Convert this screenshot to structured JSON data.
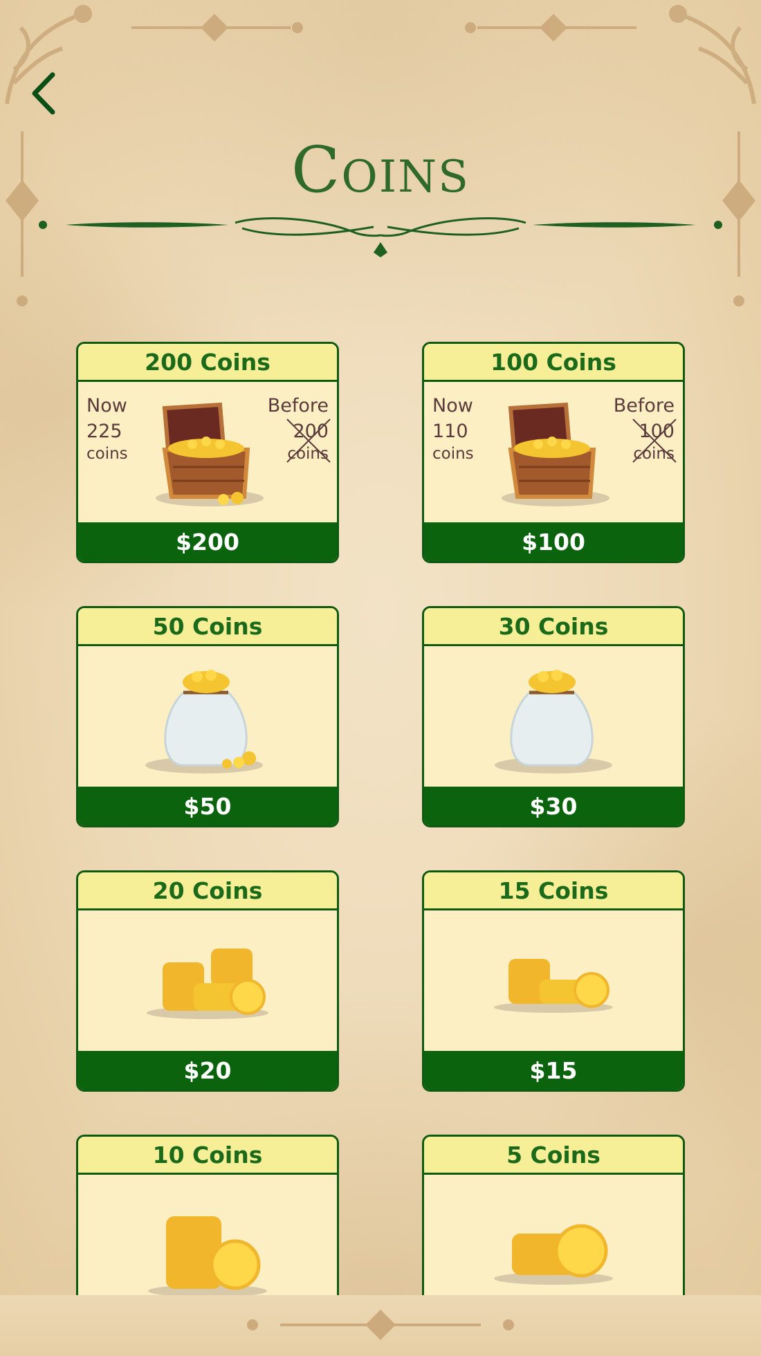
{
  "header": {
    "title": "Coins"
  },
  "packages": [
    {
      "title": "200 Coins",
      "price": "$200",
      "art": "treasure-chest",
      "promo": {
        "now_label": "Now",
        "now_value": "225",
        "now_unit": "coins",
        "before_label": "Before",
        "before_value": "200",
        "before_unit": "coins"
      }
    },
    {
      "title": "100 Coins",
      "price": "$100",
      "art": "treasure-chest",
      "promo": {
        "now_label": "Now",
        "now_value": "110",
        "now_unit": "coins",
        "before_label": "Before",
        "before_value": "100",
        "before_unit": "coins"
      }
    },
    {
      "title": "50 Coins",
      "price": "$50",
      "art": "coin-bag"
    },
    {
      "title": "30 Coins",
      "price": "$30",
      "art": "coin-bag"
    },
    {
      "title": "20 Coins",
      "price": "$20",
      "art": "coin-stacks-large"
    },
    {
      "title": "15 Coins",
      "price": "$15",
      "art": "coin-stacks-medium"
    },
    {
      "title": "10 Coins",
      "price": "",
      "art": "coin-stack-tall"
    },
    {
      "title": "5 Coins",
      "price": "",
      "art": "coin-stack-small"
    }
  ],
  "colors": {
    "accent_green": "#0b630d",
    "title_green": "#2f6a2a",
    "card_header": "#f7ee98",
    "card_body": "#fcefc3",
    "gold": "#f5c431"
  },
  "icons": {
    "back": "chevron-left-icon"
  }
}
